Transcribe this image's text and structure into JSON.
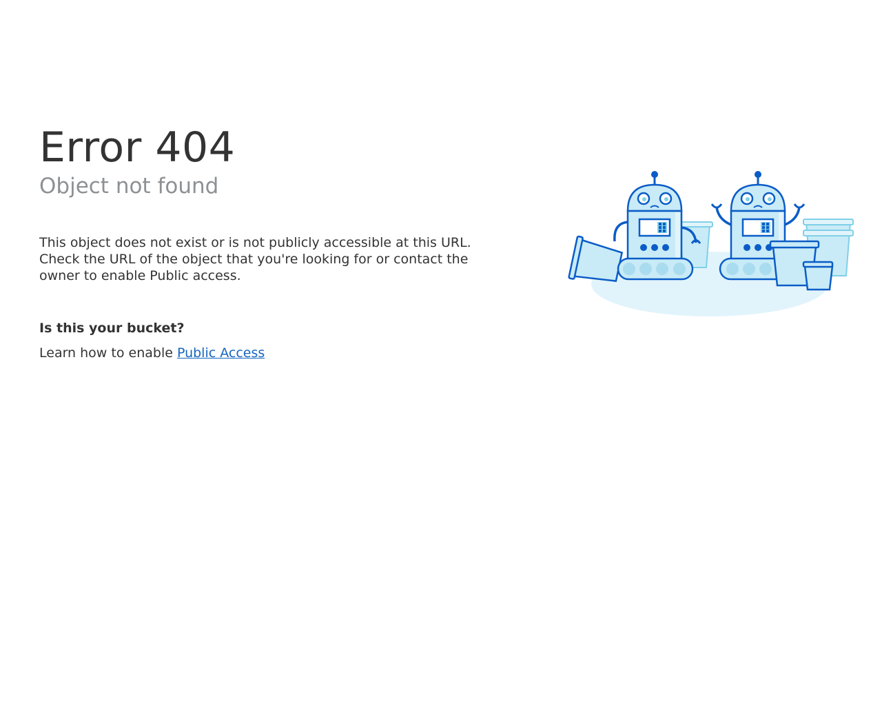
{
  "error": {
    "title": "Error 404",
    "subtitle": "Object not found",
    "description_lines": [
      "This object does not exist or is not publicly accessible at this URL.",
      "Check the URL of the object that you're looking for or contact the",
      "owner to enable Public access."
    ]
  },
  "help": {
    "question": "Is this your bucket?",
    "learn_prefix": "Learn how to enable ",
    "link_label": "Public Access"
  },
  "illustration": {
    "icon": "sad-robots-with-buckets-illustration",
    "colors": {
      "outline": "#0b5cc7",
      "fill": "#c8ebf7",
      "light": "#e2f4fb",
      "accent": "#7fd0e8"
    }
  }
}
